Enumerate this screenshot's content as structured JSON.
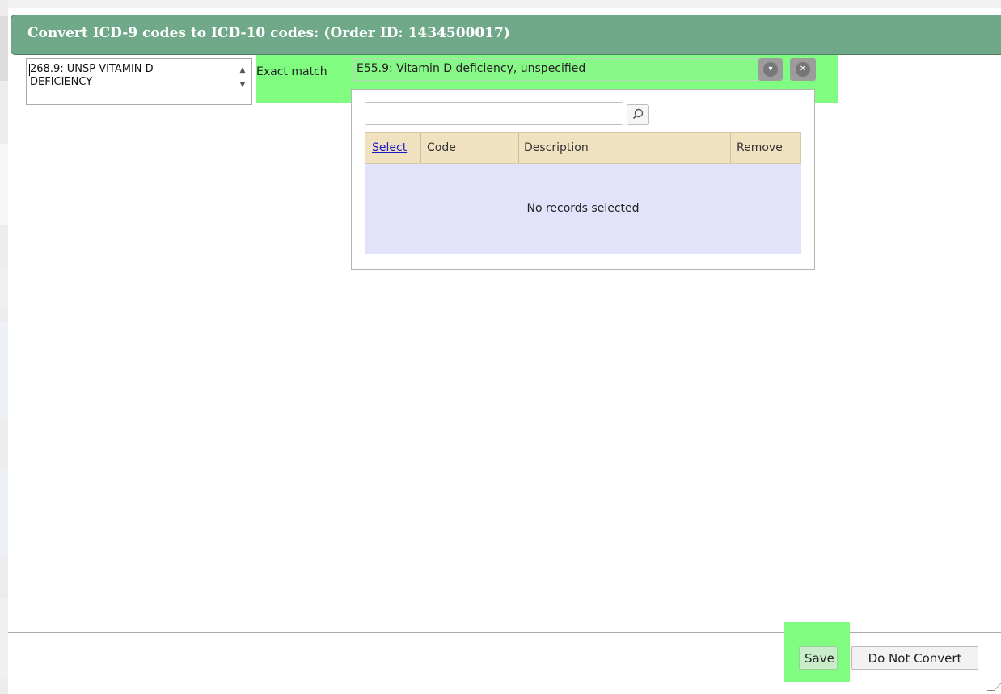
{
  "dialog": {
    "title": "Convert ICD-9 codes to ICD-10 codes: (Order ID: 1434500017)"
  },
  "source_code": {
    "value": "268.9: UNSP VITAMIN D DEFICIENCY"
  },
  "match": {
    "label": "Exact match",
    "selected_value": "E55.9: Vitamin D deficiency, unspecified"
  },
  "picker": {
    "search_placeholder": "",
    "columns": [
      "Select",
      "Code",
      "Description",
      "Remove"
    ],
    "empty_message": "No records selected"
  },
  "footer": {
    "save_label": "Save",
    "do_not_convert_label": "Do Not Convert"
  },
  "icons": {
    "dropdown": "chevron-down-icon",
    "clear": "clear-icon",
    "search": "search-icon",
    "spinner_up": "spinner-up-icon",
    "spinner_down": "spinner-down-icon"
  },
  "colors": {
    "title_bar": "#6fa98a",
    "highlight": "#80fc80",
    "table_header": "#f0e2c1",
    "table_body": "#e2e2fb"
  }
}
